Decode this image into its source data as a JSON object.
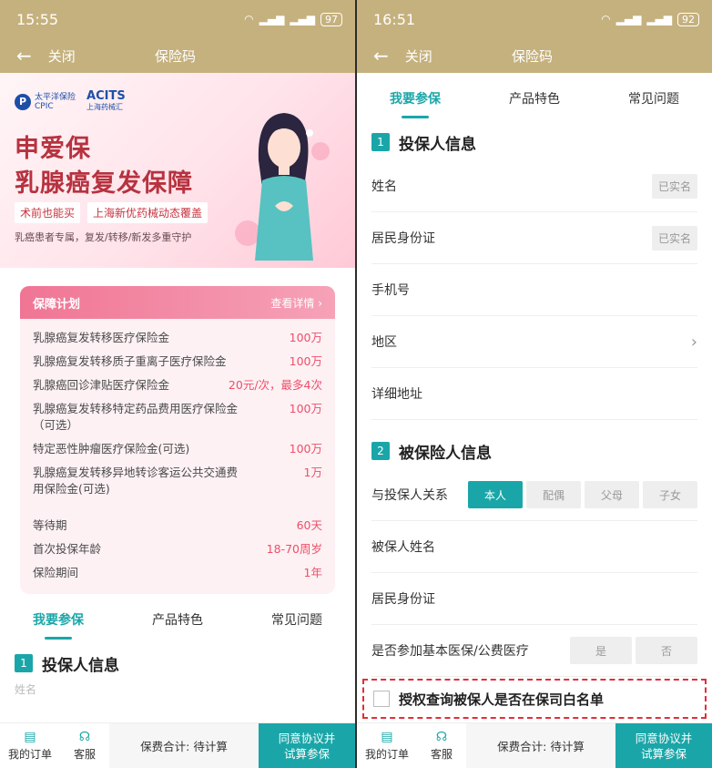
{
  "left": {
    "status": {
      "time": "15:55",
      "battery": "97"
    },
    "nav": {
      "close": "关闭",
      "title": "保险码"
    },
    "banner": {
      "cpic_name": "太平洋保险",
      "cpic_en": "CPIC",
      "acits": "ACITS",
      "acits_cn": "上海药械汇",
      "title_line1": "申爱保",
      "title_line2": "乳腺癌复发保障",
      "tag1": "术前也能买",
      "tag2": "上海新优药械动态覆盖",
      "subtitle": "乳癌患者专属，复发/转移/新发多重守护"
    },
    "plan": {
      "title": "保障计划",
      "more": "查看详情",
      "items": [
        {
          "k": "乳腺癌复发转移医疗保险金",
          "v": "100万"
        },
        {
          "k": "乳腺癌复发转移质子重离子医疗保险金",
          "v": "100万"
        },
        {
          "k": "乳腺癌回诊津贴医疗保险金",
          "v": "20元/次，最多4次"
        },
        {
          "k": "乳腺癌复发转移特定药品费用医疗保险金（可选）",
          "v": "100万"
        },
        {
          "k": "特定恶性肿瘤医疗保险金(可选)",
          "v": "100万"
        },
        {
          "k": "乳腺癌复发转移异地转诊客运公共交通费用保险金(可选)",
          "v": "1万"
        }
      ],
      "terms": [
        {
          "k": "等待期",
          "v": "60天"
        },
        {
          "k": "首次投保年龄",
          "v": "18-70周岁"
        },
        {
          "k": "保险期间",
          "v": "1年"
        }
      ]
    },
    "peek": "姓名"
  },
  "right": {
    "status": {
      "time": "16:51",
      "battery": "92"
    },
    "nav": {
      "close": "关闭",
      "title": "保险码"
    }
  },
  "tabs": [
    "我要参保",
    "产品特色",
    "常见问题"
  ],
  "section1": {
    "num": "1",
    "title": "投保人信息",
    "name_label": "姓名",
    "id_label": "居民身份证",
    "verified": "已实名",
    "phone_label": "手机号",
    "region_label": "地区",
    "address_label": "详细地址"
  },
  "section2": {
    "num": "2",
    "title": "被保险人信息",
    "relation_label": "与投保人关系",
    "relations": [
      "本人",
      "配偶",
      "父母",
      "子女"
    ],
    "name_label": "被保人姓名",
    "id_label": "居民身份证",
    "medical_label": "是否参加基本医保/公费医疗",
    "yes": "是",
    "no": "否",
    "auth_text": "授权查询被保人是否在保司白名单"
  },
  "bottom": {
    "orders": "我的订单",
    "service": "客服",
    "fee": "保费合计: 待计算",
    "cta_line1": "同意协议并",
    "cta_line2": "试算参保"
  }
}
